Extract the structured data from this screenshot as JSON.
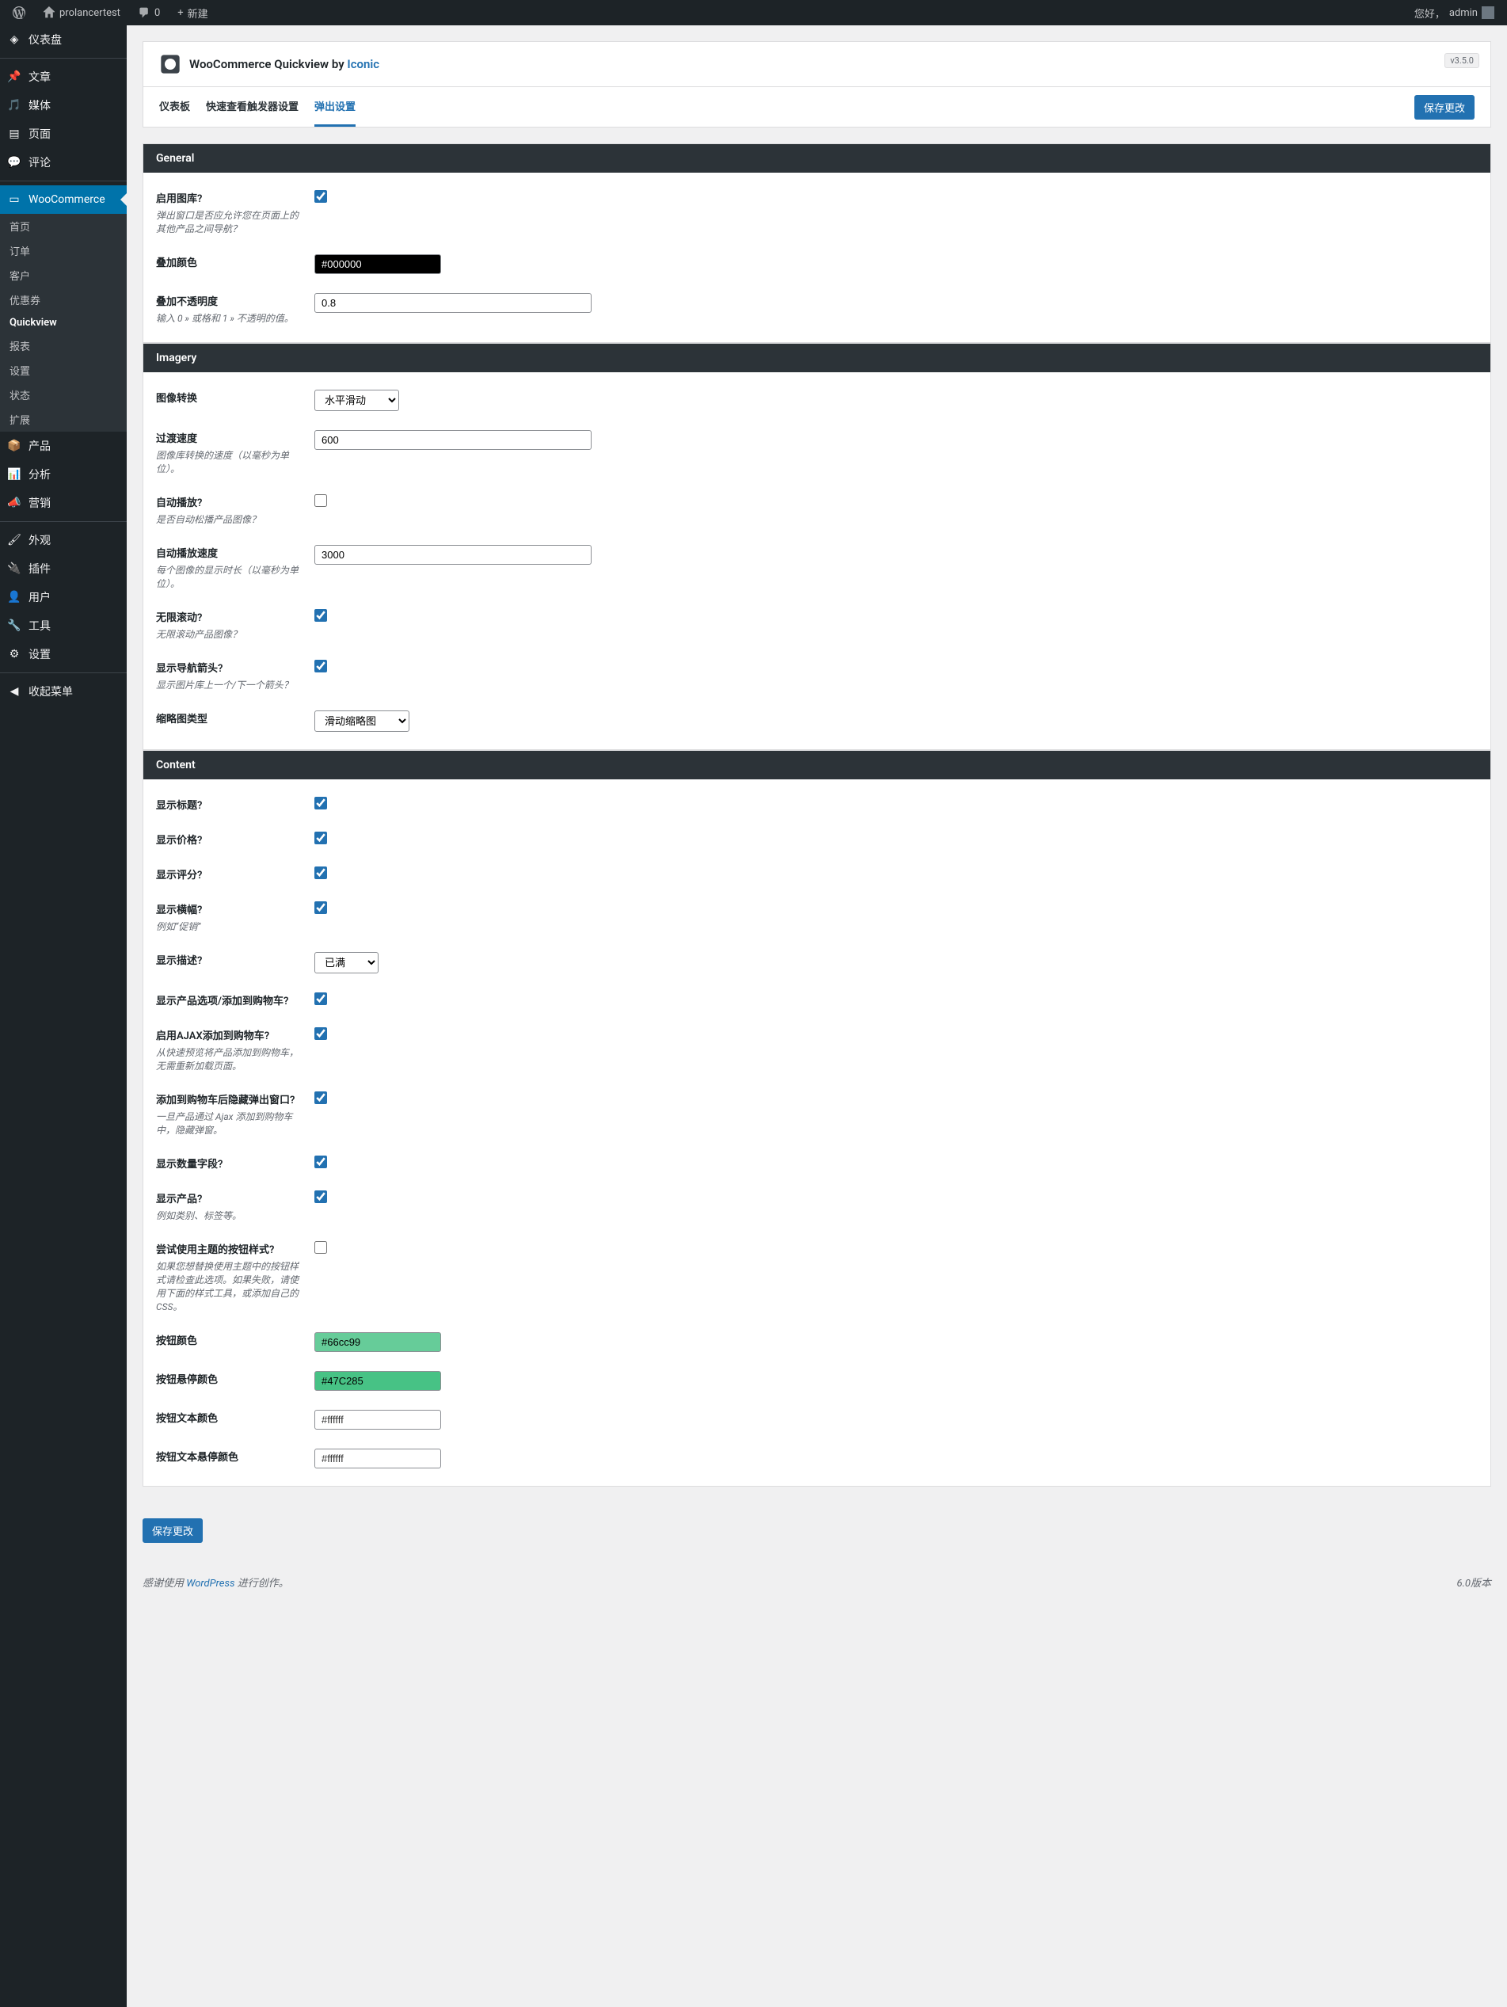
{
  "adminBar": {
    "siteName": "prolancertest",
    "commentsCount": "0",
    "newLabel": "新建",
    "greeting": "您好，",
    "username": "admin"
  },
  "sidebar": {
    "items": [
      {
        "label": "仪表盘",
        "icon": "dashboard"
      },
      {
        "label": "文章",
        "icon": "pin"
      },
      {
        "label": "媒体",
        "icon": "media"
      },
      {
        "label": "页面",
        "icon": "page"
      },
      {
        "label": "评论",
        "icon": "comment"
      },
      {
        "label": "WooCommerce",
        "icon": "woo",
        "current": true
      },
      {
        "label": "产品",
        "icon": "product"
      },
      {
        "label": "分析",
        "icon": "analytics"
      },
      {
        "label": "营销",
        "icon": "marketing"
      },
      {
        "label": "外观",
        "icon": "appearance"
      },
      {
        "label": "插件",
        "icon": "plugins"
      },
      {
        "label": "用户",
        "icon": "users"
      },
      {
        "label": "工具",
        "icon": "tools"
      },
      {
        "label": "设置",
        "icon": "settings"
      },
      {
        "label": "收起菜单",
        "icon": "collapse"
      }
    ],
    "wooSub": [
      "首页",
      "订单",
      "客户",
      "优惠券",
      "Quickview",
      "报表",
      "设置",
      "状态",
      "扩展"
    ]
  },
  "header": {
    "title": "WooCommerce Quickview by ",
    "brand": "Iconic",
    "version": "v3.5.0"
  },
  "tabs": {
    "items": [
      "仪表板",
      "快速查看触发器设置",
      "弹出设置"
    ],
    "saveBtn": "保存更改"
  },
  "sections": [
    {
      "title": "General",
      "fields": [
        {
          "key": "enable_gallery",
          "label": "启用图库?",
          "desc": "弹出窗口是否应允许您在页面上的其他产品之间导航？",
          "type": "checkbox",
          "value": true
        },
        {
          "key": "overlay_color",
          "label": "叠加颜色",
          "type": "color",
          "value": "#000000",
          "cls": "color-dark"
        },
        {
          "key": "overlay_opacity",
          "label": "叠加不透明度",
          "desc": "输入 0 » 或格和 1 » 不透明的值。",
          "type": "text",
          "value": "0.8"
        }
      ]
    },
    {
      "title": "Imagery",
      "fields": [
        {
          "key": "image_transition",
          "label": "图像转换",
          "type": "select",
          "value": "水平滑动"
        },
        {
          "key": "transition_speed",
          "label": "过渡速度",
          "desc": "图像库转换的速度（以毫秒为单位）。",
          "type": "text",
          "value": "600"
        },
        {
          "key": "autoplay",
          "label": "自动播放?",
          "desc": "是否自动松播产品图像？",
          "type": "checkbox",
          "value": false
        },
        {
          "key": "autoplay_speed",
          "label": "自动播放速度",
          "desc": "每个图像的显示时长（以毫秒为单位）。",
          "type": "text",
          "value": "3000"
        },
        {
          "key": "infinite_scroll",
          "label": "无限滚动?",
          "desc": "无限滚动产品图像？",
          "type": "checkbox",
          "value": true
        },
        {
          "key": "show_arrows",
          "label": "显示导航箭头?",
          "desc": "显示图片库上一个/下一个箭头？",
          "type": "checkbox",
          "value": true
        },
        {
          "key": "thumb_type",
          "label": "缩略图类型",
          "type": "select",
          "value": "滑动缩略图"
        }
      ]
    },
    {
      "title": "Content",
      "fields": [
        {
          "key": "show_title",
          "label": "显示标题?",
          "type": "checkbox",
          "value": true
        },
        {
          "key": "show_price",
          "label": "显示价格?",
          "type": "checkbox",
          "value": true
        },
        {
          "key": "show_rating",
          "label": "显示评分?",
          "type": "checkbox",
          "value": true
        },
        {
          "key": "show_banner",
          "label": "显示横幅?",
          "desc": "例如“促销”",
          "type": "checkbox",
          "value": true
        },
        {
          "key": "show_desc",
          "label": "显示描述?",
          "type": "select",
          "value": "已满"
        },
        {
          "key": "show_options",
          "label": "显示产品选项/添加到购物车?",
          "type": "checkbox",
          "value": true
        },
        {
          "key": "ajax_cart",
          "label": "启用AJAX添加到购物车?",
          "desc": "从快速预览将产品添加到购物车，无需重新加载页面。",
          "type": "checkbox",
          "value": true
        },
        {
          "key": "hide_after_add",
          "label": "添加到购物车后隐藏弹出窗口?",
          "desc": "一旦产品通过 Ajax 添加到购物车中，隐藏弹窗。",
          "type": "checkbox",
          "value": true
        },
        {
          "key": "show_qty",
          "label": "显示数量字段?",
          "type": "checkbox",
          "value": true
        },
        {
          "key": "show_product",
          "label": "显示产品?",
          "desc": "例如类别、标签等。",
          "type": "checkbox",
          "value": true
        },
        {
          "key": "theme_btn",
          "label": "尝试使用主题的按钮样式?",
          "desc": "如果您想替换使用主题中的按钮样式请检查此选项。如果失败，请使用下面的样式工具，或添加自己的CSS。",
          "type": "checkbox",
          "value": false
        },
        {
          "key": "btn_color",
          "label": "按钮颜色",
          "type": "color",
          "value": "#66cc99",
          "cls": "color-green1"
        },
        {
          "key": "btn_hover",
          "label": "按钮悬停颜色",
          "type": "color",
          "value": "#47C285",
          "cls": "color-green2"
        },
        {
          "key": "btn_text",
          "label": "按钮文本颜色",
          "type": "color",
          "value": "#ffffff",
          "cls": "color-white"
        },
        {
          "key": "btn_text_hover",
          "label": "按钮文本悬停颜色",
          "type": "color",
          "value": "#ffffff",
          "cls": "color-white"
        }
      ]
    }
  ],
  "submitBtn": "保存更改",
  "footer": {
    "thanksPrefix": "感谢使用",
    "wpLink": "WordPress",
    "thanksSuffix": "进行创作。",
    "version": "6.0版本"
  }
}
